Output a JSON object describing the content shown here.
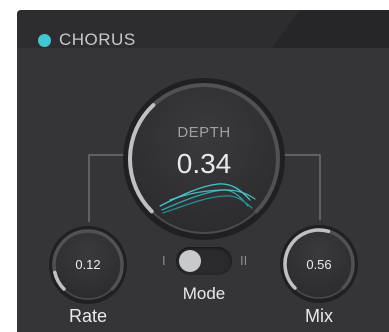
{
  "title": "CHORUS",
  "colors": {
    "accent": "#41c8d2",
    "panel": "#353537",
    "text": "#e9e9ea"
  },
  "depth": {
    "label": "DEPTH",
    "value": "0.34",
    "level": 0.34
  },
  "rate": {
    "label": "Rate",
    "value": "0.12",
    "level": 0.12
  },
  "mix": {
    "label": "Mix",
    "value": "0.56",
    "level": 0.56
  },
  "mode": {
    "label": "Mode",
    "left_mark": "I",
    "right_mark": "II",
    "selected": "I"
  }
}
